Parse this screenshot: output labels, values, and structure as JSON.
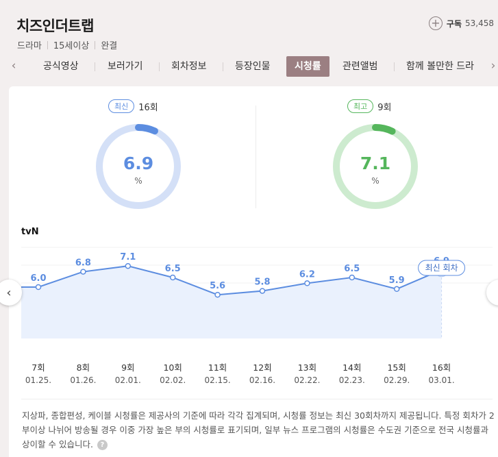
{
  "program": {
    "title": "치즈인더트랩",
    "genre": "드라마",
    "rating": "15세이상",
    "status": "완결"
  },
  "subscribe": {
    "icon": "plus-icon",
    "label": "구독",
    "count": "53,458"
  },
  "tabs": [
    {
      "label": "공식영상"
    },
    {
      "label": "보러가기"
    },
    {
      "label": "회차정보"
    },
    {
      "label": "등장인물"
    },
    {
      "label": "시청률",
      "active": true
    },
    {
      "label": "관련앨범"
    },
    {
      "label": "함께 볼만한 드라"
    }
  ],
  "gauges": {
    "latest": {
      "badge": "최신",
      "episode": "16회",
      "value": "6.9",
      "unit": "%",
      "fraction": 0.069,
      "color": "#5c8de0",
      "track": "#d4e0f7"
    },
    "best": {
      "badge": "최고",
      "episode": "9회",
      "value": "7.1",
      "unit": "%",
      "fraction": 0.071,
      "color": "#55b65c",
      "track": "#cdebcf"
    }
  },
  "chart_data": {
    "type": "area",
    "title": "tvN",
    "xlabel": "",
    "ylabel": "",
    "ylim": [
      0,
      10
    ],
    "grid": true,
    "categories": [
      "7회",
      "8회",
      "9회",
      "10회",
      "11회",
      "12회",
      "13회",
      "14회",
      "15회",
      "16회"
    ],
    "dates": [
      "01.25.",
      "01.26.",
      "02.01.",
      "02.02.",
      "02.15.",
      "02.16.",
      "02.22.",
      "02.23.",
      "02.29.",
      "03.01."
    ],
    "series": [
      {
        "values": [
          6.0,
          6.8,
          7.1,
          6.5,
          5.6,
          5.8,
          6.2,
          6.5,
          5.9,
          6.9
        ],
        "labels": [
          "6.0",
          "6.8",
          "7.1",
          "6.5",
          "5.6",
          "5.8",
          "6.2",
          "6.5",
          "5.9",
          "6.9"
        ]
      }
    ],
    "highlight_label": "최신 회차",
    "highlight_index": 9,
    "line_color": "#5c8de0",
    "fill_color": "#eaf1fd"
  },
  "notice": {
    "text": "지상파, 종합편성, 케이블 시청률은 제공사의 기준에 따라 각각 집계되며, 시청률 정보는 최신 30회차까지 제공됩니다. 특정 회차가 2부이상 나뉘어 방송될 경우 이중 가장 높은 부의 시청률로 표기되며, 일부 뉴스 프로그램의 시청률은 수도권 기준으로 전국 시청률과 상이할 수 있습니다.",
    "help_icon": "question-icon",
    "help_glyph": "?"
  },
  "nav": {
    "prev": "‹",
    "next": "›",
    "tab_prev": "‹",
    "tab_next": "›"
  }
}
